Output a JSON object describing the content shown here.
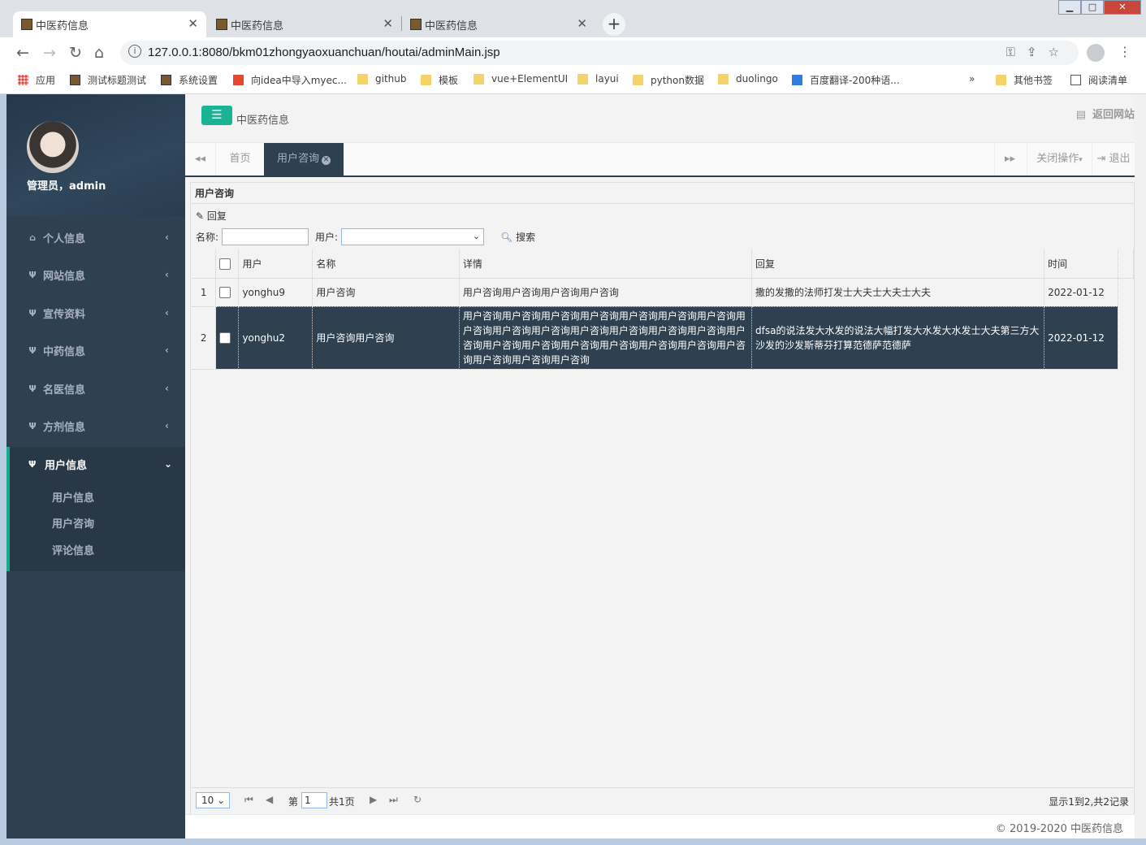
{
  "browser": {
    "tabs": [
      {
        "title": "中医药信息"
      },
      {
        "title": "中医药信息"
      },
      {
        "title": "中医药信息"
      }
    ],
    "url": "127.0.0.1:8080/bkm01zhongyaoxuanchuan/houtai/adminMain.jsp",
    "bookmarks": [
      "应用",
      "测试标题测试",
      "系统设置",
      "向idea中导入myec...",
      "github",
      "模板",
      "vue+ElementUI",
      "layui",
      "python数据",
      "duolingo",
      "百度翻译-200种语..."
    ],
    "more_bookmarks": "»",
    "other_bookmarks": "其他书签",
    "reading_list": "阅读清单"
  },
  "sidebar": {
    "admin_name": "管理员，admin",
    "menu": [
      {
        "label": "个人信息",
        "icon": "home-icon"
      },
      {
        "label": "网站信息",
        "icon": "cutlery-icon"
      },
      {
        "label": "宣传资料",
        "icon": "cutlery-icon"
      },
      {
        "label": "中药信息",
        "icon": "cutlery-icon"
      },
      {
        "label": "名医信息",
        "icon": "cutlery-icon"
      },
      {
        "label": "方剂信息",
        "icon": "cutlery-icon"
      }
    ],
    "active_menu": {
      "label": "用户信息",
      "items": [
        "用户信息",
        "用户咨询",
        "评论信息"
      ]
    }
  },
  "header": {
    "title": "中医药信息",
    "back_site": "返回网站"
  },
  "tabs": {
    "home": "首页",
    "current": "用户咨询",
    "close_ops": "关闭操作",
    "logout": "退出"
  },
  "panel": {
    "title": "用户咨询",
    "reply_button": "回复",
    "name_label": "名称:",
    "user_label": "用户:",
    "search_button": "搜索",
    "columns": [
      "用户",
      "名称",
      "详情",
      "回复",
      "时间"
    ],
    "rows": [
      {
        "num": "1",
        "user": "yonghu9",
        "name": "用户咨询",
        "detail": "用户咨询用户咨询用户咨询用户咨询",
        "reply": "撒的发撒的法师打发士大夫士大夫士大夫",
        "time": "2022-01-12"
      },
      {
        "num": "2",
        "user": "yonghu2",
        "name": "用户咨询用户咨询",
        "detail": "用户咨询用户咨询用户咨询用户咨询用户咨询用户咨询用户咨询用户咨询用户咨询用户咨询用户咨询用户咨询用户咨询用户咨询用户咨询用户咨询用户咨询用户咨询用户咨询用户咨询用户咨询用户咨询用户咨询用户咨询用户咨询",
        "reply": "dfsa的说法发大水发的说法大幅打发大水发大水发士大夫第三方大沙发的沙发斯蒂芬打算范德萨范德萨",
        "time": "2022-01-12"
      }
    ]
  },
  "pager": {
    "page_size": "10",
    "page_prefix": "第",
    "page_value": "1",
    "page_total": "共1页",
    "info": "显示1到2,共2记录"
  },
  "footer": "© 2019-2020 中医药信息"
}
